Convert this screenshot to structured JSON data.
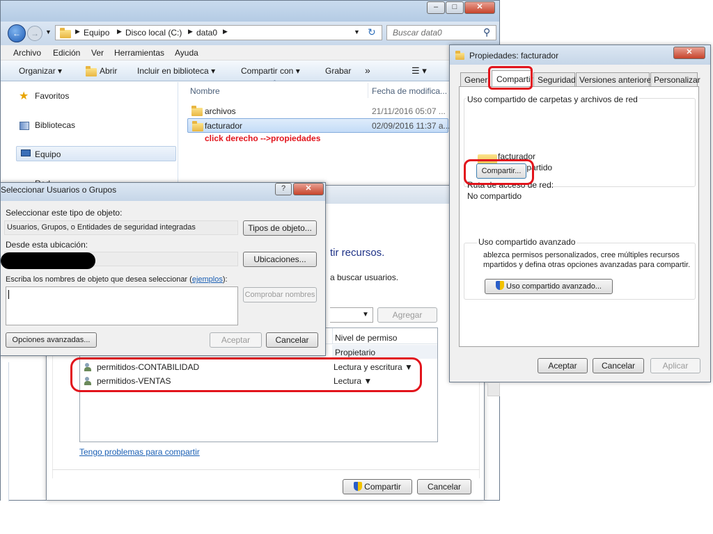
{
  "explorer": {
    "address": [
      "Equipo",
      "Disco local (C:)",
      "data0"
    ],
    "search_placeholder": "Buscar data0",
    "menu": [
      "Archivo",
      "Edición",
      "Ver",
      "Herramientas",
      "Ayuda"
    ],
    "toolbar": [
      "Organizar",
      "Abrir",
      "Incluir en biblioteca",
      "Compartir con",
      "Grabar",
      "»"
    ],
    "nav": [
      "Favoritos",
      "Bibliotecas",
      "Equipo",
      "Red"
    ],
    "columns": {
      "name": "Nombre",
      "date": "Fecha de modifica..."
    },
    "files": [
      {
        "name": "archivos",
        "date": "21/11/2016 05:07 ..."
      },
      {
        "name": "facturador",
        "date": "02/09/2016 11:37 a..."
      }
    ],
    "annotation": "click derecho -->propiedades"
  },
  "props": {
    "title": "Propiedades: facturador",
    "tabs": [
      "General",
      "Compartir",
      "Seguridad",
      "Versiones anteriores",
      "Personalizar"
    ],
    "group1": "Uso compartido de carpetas y archivos de red",
    "folder_name": "facturador",
    "folder_status": "No compartido",
    "path_label": "Ruta de acceso de red:",
    "path_value": "No compartido",
    "share_button": "Compartir...",
    "group2": "Uso compartido avanzado",
    "group2_text": [
      "ablezca permisos personalizados, cree múltiples recursos",
      "mpartidos y defina otras opciones avanzadas para compartir."
    ],
    "advanced_button": "Uso compartido avanzado...",
    "ok": "Aceptar",
    "cancel": "Cancelar",
    "apply": "Aplicar"
  },
  "share": {
    "heading": "tir recursos.",
    "subtext": "a buscar usuarios.",
    "add_button": "Agregar",
    "col_level": "Nivel de permiso",
    "owner_level": "Propietario",
    "users": [
      {
        "name": "permitidos-CONTABILIDAD",
        "level": "Lectura y escritura"
      },
      {
        "name": "permitidos-VENTAS",
        "level": "Lectura"
      }
    ],
    "help_link": "Tengo problemas para compartir",
    "share_button": "Compartir",
    "cancel_button": "Cancelar"
  },
  "select": {
    "title": "Seleccionar Usuarios o Grupos",
    "type_label": "Seleccionar este tipo de objeto:",
    "type_value": "Usuarios, Grupos, o Entidades de seguridad integradas",
    "type_button": "Tipos de objeto...",
    "location_label": "Desde esta ubicación:",
    "location_button": "Ubicaciones...",
    "names_label_pre": "Escriba los nombres de objeto que desea seleccionar (",
    "names_label_link": "ejemplos",
    "names_label_post": "):",
    "check_button": "Comprobar nombres",
    "advanced_button": "Opciones avanzadas...",
    "ok_button": "Aceptar",
    "cancel_button": "Cancelar"
  }
}
